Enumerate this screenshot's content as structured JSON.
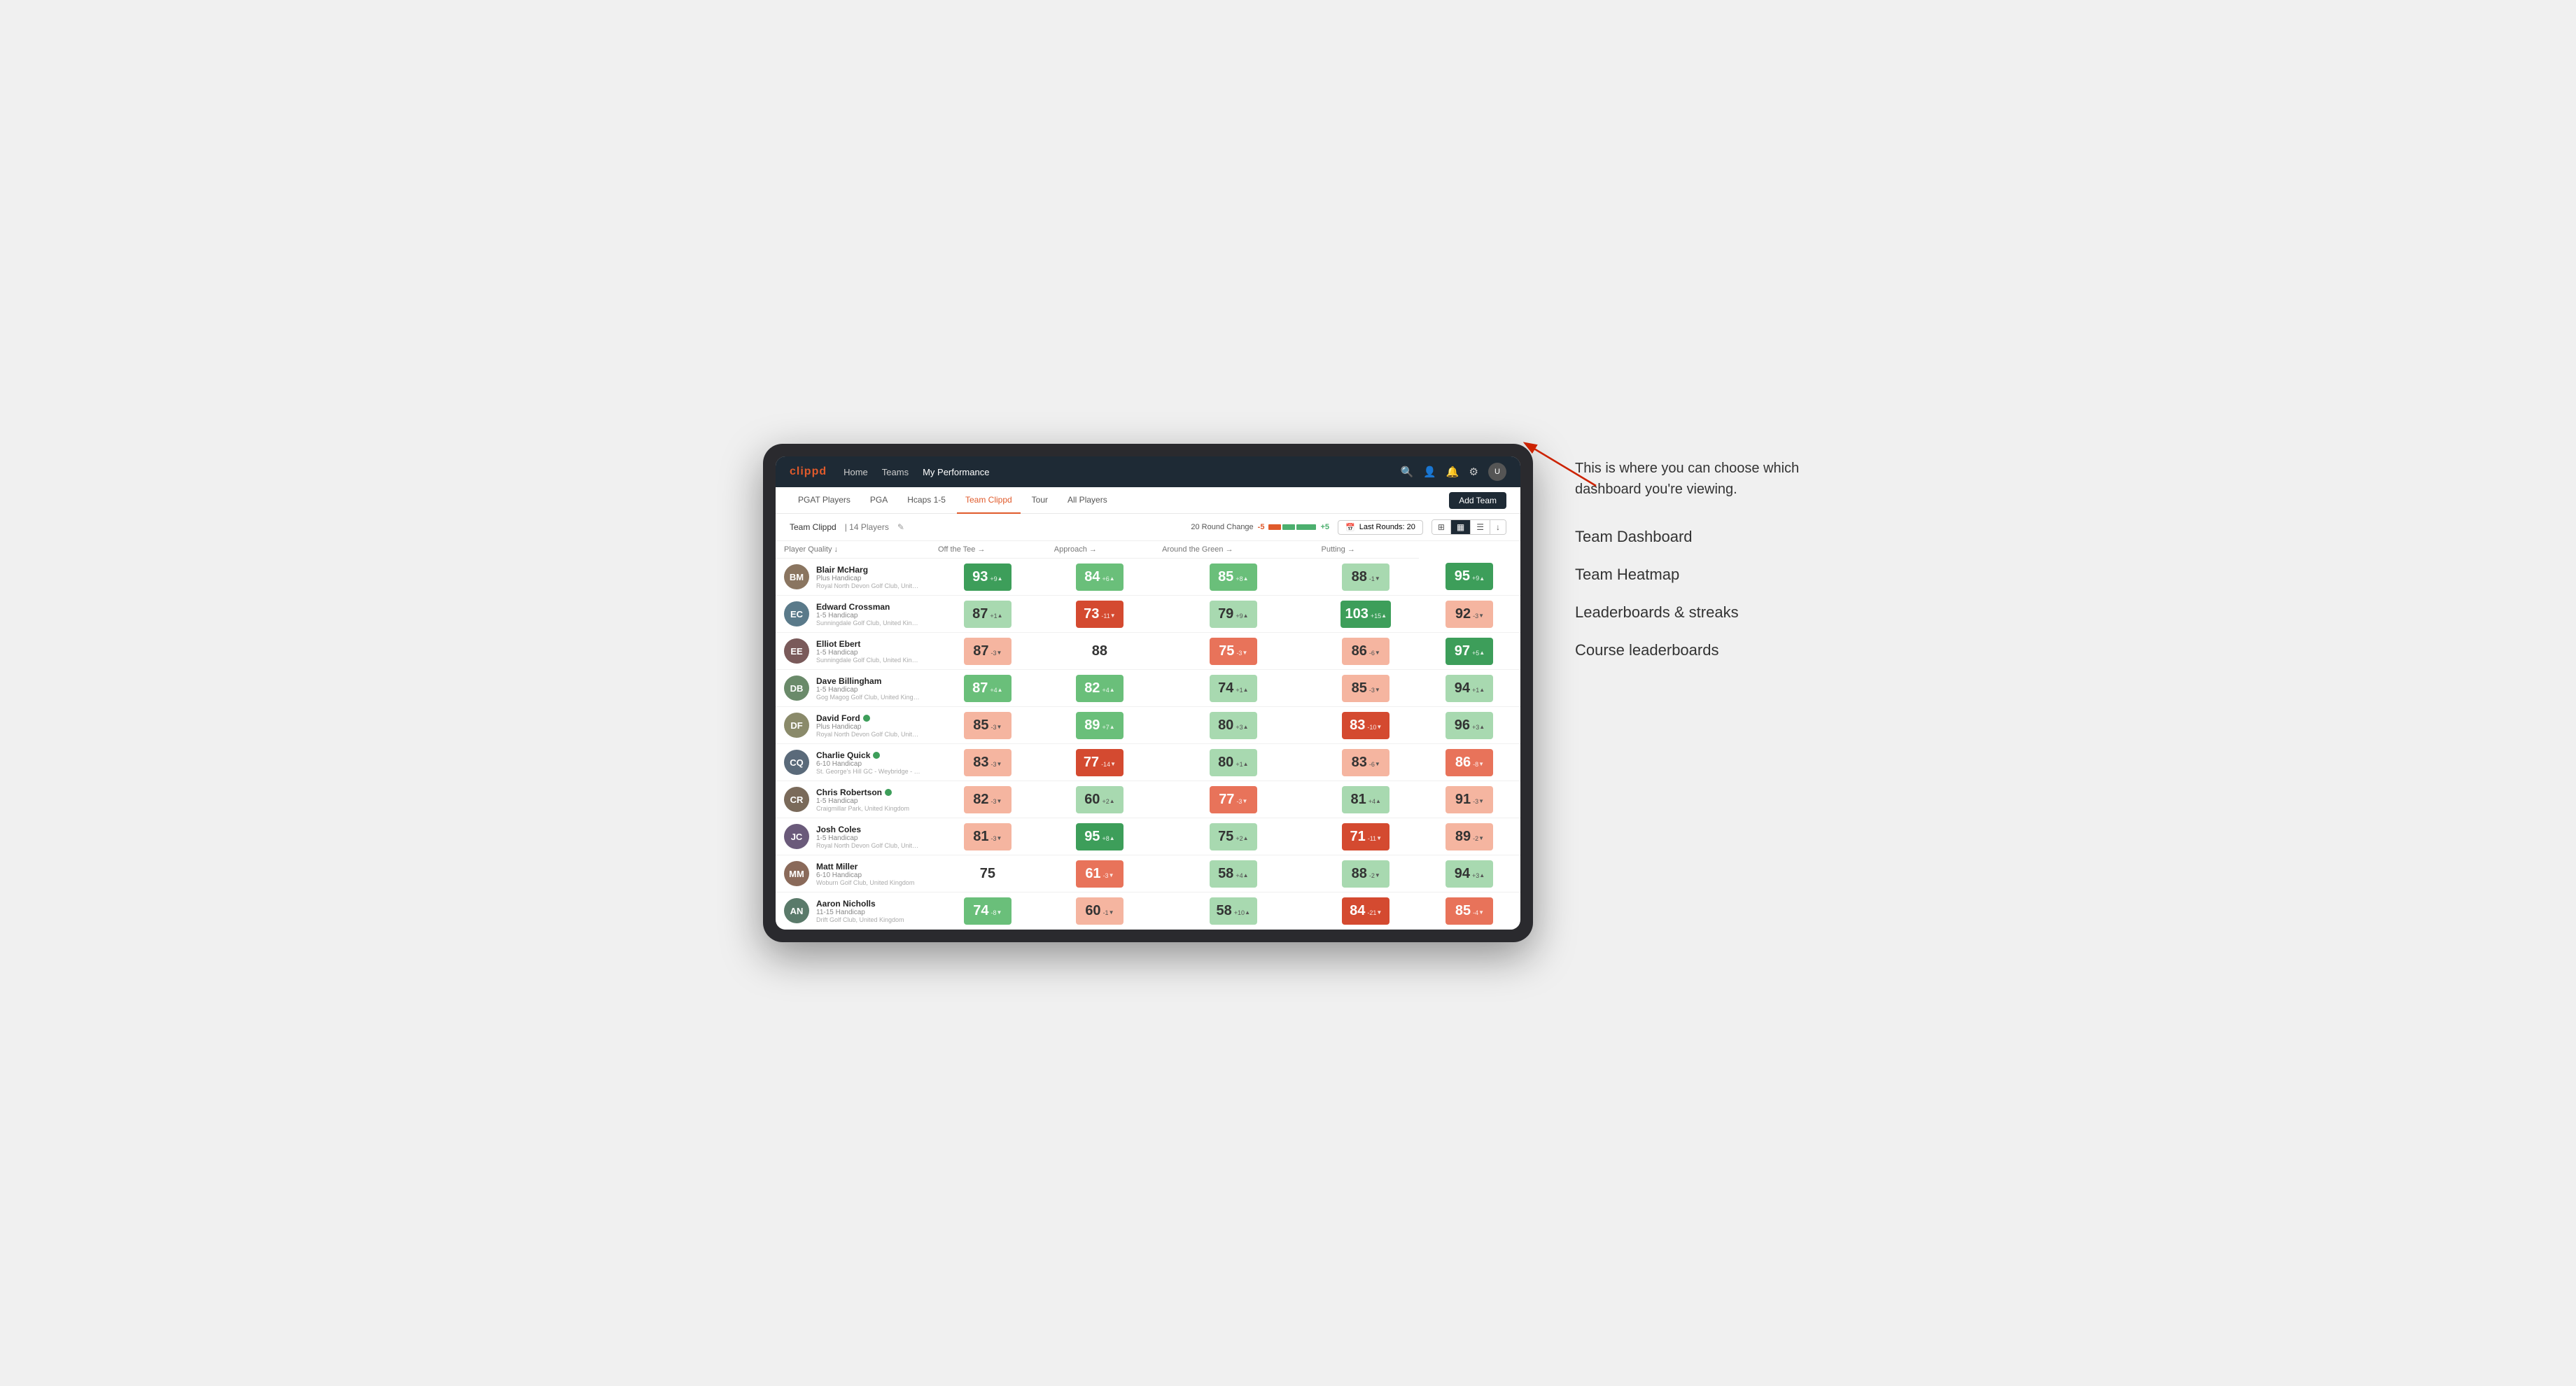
{
  "callout": {
    "text": "This is where you can choose which dashboard you're viewing.",
    "menu_items": [
      "Team Dashboard",
      "Team Heatmap",
      "Leaderboards & streaks",
      "Course leaderboards"
    ]
  },
  "nav": {
    "logo": "clippd",
    "links": [
      "Home",
      "Teams",
      "My Performance"
    ],
    "active_link": "My Performance"
  },
  "sub_nav": {
    "items": [
      "PGAT Players",
      "PGA",
      "Hcaps 1-5",
      "Team Clippd",
      "Tour",
      "All Players"
    ],
    "active": "Team Clippd",
    "add_team_label": "Add Team"
  },
  "team_header": {
    "name": "Team Clippd",
    "separator": "|",
    "count": "14 Players",
    "round_change_label": "20 Round Change",
    "minus_val": "-5",
    "plus_val": "+5",
    "last_rounds_label": "Last Rounds:",
    "last_rounds_val": "20"
  },
  "table": {
    "headers": [
      "Player Quality ↓",
      "Off the Tee →",
      "Approach →",
      "Around the Green →",
      "Putting →"
    ],
    "rows": [
      {
        "name": "Blair McHarg",
        "handicap": "Plus Handicap",
        "club": "Royal North Devon Golf Club, United Kingdom",
        "avatar_color": "#8a7560",
        "scores": [
          {
            "val": 93,
            "change": "+9",
            "dir": "up",
            "color": "bg-green-dark"
          },
          {
            "val": 84,
            "change": "+6",
            "dir": "up",
            "color": "bg-green-mid"
          },
          {
            "val": 85,
            "change": "+8",
            "dir": "up",
            "color": "bg-green-mid"
          },
          {
            "val": 88,
            "change": "-1",
            "dir": "down",
            "color": "bg-green-light"
          },
          {
            "val": 95,
            "change": "+9",
            "dir": "up",
            "color": "bg-green-dark"
          }
        ]
      },
      {
        "name": "Edward Crossman",
        "handicap": "1-5 Handicap",
        "club": "Sunningdale Golf Club, United Kingdom",
        "avatar_color": "#5a7a8a",
        "scores": [
          {
            "val": 87,
            "change": "+1",
            "dir": "up",
            "color": "bg-green-light"
          },
          {
            "val": 73,
            "change": "-11",
            "dir": "down",
            "color": "bg-red-dark"
          },
          {
            "val": 79,
            "change": "+9",
            "dir": "up",
            "color": "bg-green-light"
          },
          {
            "val": 103,
            "change": "+15",
            "dir": "up",
            "color": "bg-green-dark"
          },
          {
            "val": 92,
            "change": "-3",
            "dir": "down",
            "color": "bg-red-light"
          }
        ]
      },
      {
        "name": "Elliot Ebert",
        "handicap": "1-5 Handicap",
        "club": "Sunningdale Golf Club, United Kingdom",
        "avatar_color": "#7a5a5a",
        "scores": [
          {
            "val": 87,
            "change": "-3",
            "dir": "down",
            "color": "bg-red-light"
          },
          {
            "val": 88,
            "change": "",
            "dir": "",
            "color": "bg-white"
          },
          {
            "val": 75,
            "change": "-3",
            "dir": "down",
            "color": "bg-red-mid"
          },
          {
            "val": 86,
            "change": "-6",
            "dir": "down",
            "color": "bg-red-light"
          },
          {
            "val": 97,
            "change": "+5",
            "dir": "up",
            "color": "bg-green-dark"
          }
        ]
      },
      {
        "name": "Dave Billingham",
        "handicap": "1-5 Handicap",
        "club": "Gog Magog Golf Club, United Kingdom",
        "avatar_color": "#6a8a6a",
        "scores": [
          {
            "val": 87,
            "change": "+4",
            "dir": "up",
            "color": "bg-green-mid"
          },
          {
            "val": 82,
            "change": "+4",
            "dir": "up",
            "color": "bg-green-mid"
          },
          {
            "val": 74,
            "change": "+1",
            "dir": "up",
            "color": "bg-green-light"
          },
          {
            "val": 85,
            "change": "-3",
            "dir": "down",
            "color": "bg-red-light"
          },
          {
            "val": 94,
            "change": "+1",
            "dir": "up",
            "color": "bg-green-light"
          }
        ]
      },
      {
        "name": "David Ford",
        "handicap": "Plus Handicap",
        "club": "Royal North Devon Golf Club, United Kingdom",
        "avatar_color": "#8a8a6a",
        "verified": true,
        "scores": [
          {
            "val": 85,
            "change": "-3",
            "dir": "down",
            "color": "bg-red-light"
          },
          {
            "val": 89,
            "change": "+7",
            "dir": "up",
            "color": "bg-green-mid"
          },
          {
            "val": 80,
            "change": "+3",
            "dir": "up",
            "color": "bg-green-light"
          },
          {
            "val": 83,
            "change": "-10",
            "dir": "down",
            "color": "bg-red-dark"
          },
          {
            "val": 96,
            "change": "+3",
            "dir": "up",
            "color": "bg-green-light"
          }
        ]
      },
      {
        "name": "Charlie Quick",
        "handicap": "6-10 Handicap",
        "club": "St. George's Hill GC - Weybridge - Surrey, Uni...",
        "avatar_color": "#5a6a7a",
        "verified": true,
        "scores": [
          {
            "val": 83,
            "change": "-3",
            "dir": "down",
            "color": "bg-red-light"
          },
          {
            "val": 77,
            "change": "-14",
            "dir": "down",
            "color": "bg-red-dark"
          },
          {
            "val": 80,
            "change": "+1",
            "dir": "up",
            "color": "bg-green-light"
          },
          {
            "val": 83,
            "change": "-6",
            "dir": "down",
            "color": "bg-red-light"
          },
          {
            "val": 86,
            "change": "-8",
            "dir": "down",
            "color": "bg-red-mid"
          }
        ]
      },
      {
        "name": "Chris Robertson",
        "handicap": "1-5 Handicap",
        "club": "Craigmillar Park, United Kingdom",
        "avatar_color": "#7a6a5a",
        "verified": true,
        "scores": [
          {
            "val": 82,
            "change": "-3",
            "dir": "down",
            "color": "bg-red-light"
          },
          {
            "val": 60,
            "change": "+2",
            "dir": "up",
            "color": "bg-green-light"
          },
          {
            "val": 77,
            "change": "-3",
            "dir": "down",
            "color": "bg-red-mid"
          },
          {
            "val": 81,
            "change": "+4",
            "dir": "up",
            "color": "bg-green-light"
          },
          {
            "val": 91,
            "change": "-3",
            "dir": "down",
            "color": "bg-red-light"
          }
        ]
      },
      {
        "name": "Josh Coles",
        "handicap": "1-5 Handicap",
        "club": "Royal North Devon Golf Club, United Kingdom",
        "avatar_color": "#6a5a7a",
        "scores": [
          {
            "val": 81,
            "change": "-3",
            "dir": "down",
            "color": "bg-red-light"
          },
          {
            "val": 95,
            "change": "+8",
            "dir": "up",
            "color": "bg-green-dark"
          },
          {
            "val": 75,
            "change": "+2",
            "dir": "up",
            "color": "bg-green-light"
          },
          {
            "val": 71,
            "change": "-11",
            "dir": "down",
            "color": "bg-red-dark"
          },
          {
            "val": 89,
            "change": "-2",
            "dir": "down",
            "color": "bg-red-light"
          }
        ]
      },
      {
        "name": "Matt Miller",
        "handicap": "6-10 Handicap",
        "club": "Woburn Golf Club, United Kingdom",
        "avatar_color": "#8a6a5a",
        "scores": [
          {
            "val": 75,
            "change": "",
            "dir": "",
            "color": "bg-white"
          },
          {
            "val": 61,
            "change": "-3",
            "dir": "down",
            "color": "bg-red-mid"
          },
          {
            "val": 58,
            "change": "+4",
            "dir": "up",
            "color": "bg-green-light"
          },
          {
            "val": 88,
            "change": "-2",
            "dir": "down",
            "color": "bg-green-light"
          },
          {
            "val": 94,
            "change": "+3",
            "dir": "up",
            "color": "bg-green-light"
          }
        ]
      },
      {
        "name": "Aaron Nicholls",
        "handicap": "11-15 Handicap",
        "club": "Drift Golf Club, United Kingdom",
        "avatar_color": "#5a7a6a",
        "scores": [
          {
            "val": 74,
            "change": "-8",
            "dir": "down",
            "color": "bg-green-mid"
          },
          {
            "val": 60,
            "change": "-1",
            "dir": "down",
            "color": "bg-red-light"
          },
          {
            "val": 58,
            "change": "+10",
            "dir": "up",
            "color": "bg-green-light"
          },
          {
            "val": 84,
            "change": "-21",
            "dir": "down",
            "color": "bg-red-dark"
          },
          {
            "val": 85,
            "change": "-4",
            "dir": "down",
            "color": "bg-red-mid"
          }
        ]
      }
    ]
  }
}
